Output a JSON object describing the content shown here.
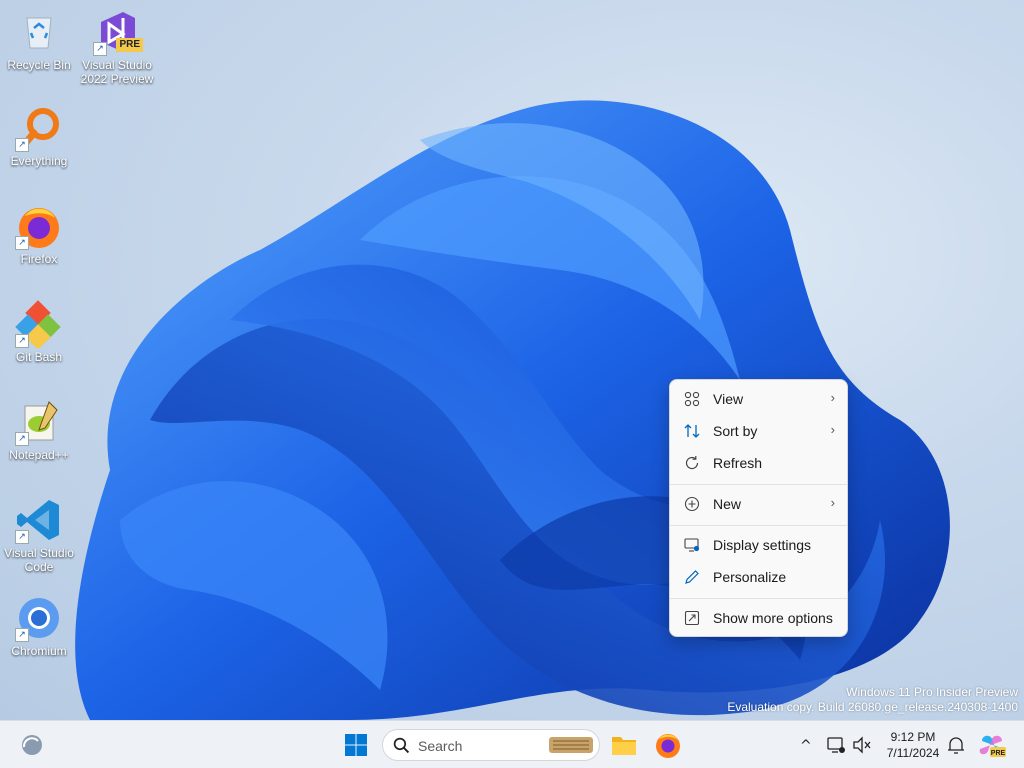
{
  "desktop": {
    "icons": [
      {
        "label": "Recycle Bin",
        "icon": "recycle-bin-icon"
      },
      {
        "label": "Visual Studio 2022 Preview",
        "icon": "visual-studio-preview-icon",
        "badge": "PRE"
      },
      {
        "label": "Everything",
        "icon": "everything-search-icon"
      },
      {
        "label": "Firefox",
        "icon": "firefox-icon"
      },
      {
        "label": "Git Bash",
        "icon": "git-bash-icon"
      },
      {
        "label": "Notepad++",
        "icon": "notepad-plus-plus-icon"
      },
      {
        "label": "Visual Studio Code",
        "icon": "vscode-icon"
      },
      {
        "label": "Chromium",
        "icon": "chromium-icon"
      }
    ],
    "watermark": {
      "line1": "Windows 11 Pro Insider Preview",
      "line2": "Evaluation copy. Build 26080.ge_release.240308-1400"
    }
  },
  "context_menu": {
    "items": [
      {
        "label": "View",
        "icon": "grid-view-icon",
        "submenu": true
      },
      {
        "label": "Sort by",
        "icon": "sort-icon",
        "submenu": true
      },
      {
        "label": "Refresh",
        "icon": "refresh-icon",
        "submenu": false
      },
      {
        "label": "New",
        "icon": "add-circle-icon",
        "submenu": true
      },
      {
        "label": "Display settings",
        "icon": "display-settings-icon",
        "submenu": false
      },
      {
        "label": "Personalize",
        "icon": "pen-icon",
        "submenu": false
      },
      {
        "label": "Show more options",
        "icon": "expand-icon",
        "submenu": false
      }
    ],
    "chevron": "›"
  },
  "taskbar": {
    "search_label": "Search",
    "time": "9:12 PM",
    "date": "7/11/2024",
    "overflow_chevron": "^"
  },
  "colors": {
    "accent": "#0067c0",
    "bloom_dark": "#0a3fbf",
    "bloom_light": "#3d8bff"
  }
}
